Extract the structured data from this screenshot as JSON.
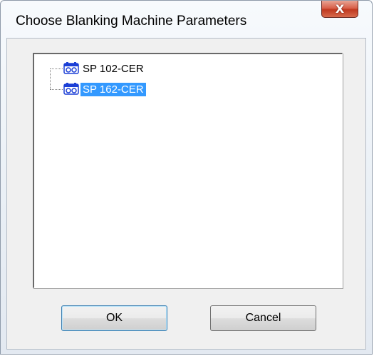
{
  "window": {
    "title": "Choose Blanking Machine Parameters",
    "close_label": "X"
  },
  "tree": {
    "items": [
      {
        "label": "SP 102-CER",
        "icon": "machine-icon",
        "selected": false
      },
      {
        "label": "SP 162-CER",
        "icon": "machine-icon",
        "selected": true
      }
    ]
  },
  "buttons": {
    "ok_label": "OK",
    "cancel_label": "Cancel"
  },
  "colors": {
    "selection": "#3399ff",
    "close_button": "#c0391f",
    "icon_blue": "#1b3fd6"
  }
}
